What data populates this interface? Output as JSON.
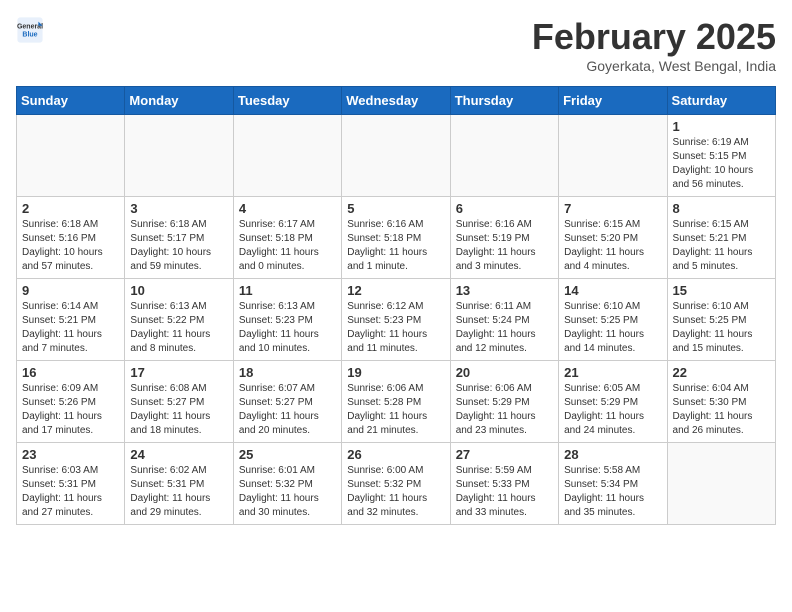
{
  "header": {
    "logo_line1": "General",
    "logo_line2": "Blue",
    "month_year": "February 2025",
    "location": "Goyerkata, West Bengal, India"
  },
  "days_of_week": [
    "Sunday",
    "Monday",
    "Tuesday",
    "Wednesday",
    "Thursday",
    "Friday",
    "Saturday"
  ],
  "weeks": [
    [
      {
        "day": "",
        "info": ""
      },
      {
        "day": "",
        "info": ""
      },
      {
        "day": "",
        "info": ""
      },
      {
        "day": "",
        "info": ""
      },
      {
        "day": "",
        "info": ""
      },
      {
        "day": "",
        "info": ""
      },
      {
        "day": "1",
        "info": "Sunrise: 6:19 AM\nSunset: 5:15 PM\nDaylight: 10 hours and 56 minutes."
      }
    ],
    [
      {
        "day": "2",
        "info": "Sunrise: 6:18 AM\nSunset: 5:16 PM\nDaylight: 10 hours and 57 minutes."
      },
      {
        "day": "3",
        "info": "Sunrise: 6:18 AM\nSunset: 5:17 PM\nDaylight: 10 hours and 59 minutes."
      },
      {
        "day": "4",
        "info": "Sunrise: 6:17 AM\nSunset: 5:18 PM\nDaylight: 11 hours and 0 minutes."
      },
      {
        "day": "5",
        "info": "Sunrise: 6:16 AM\nSunset: 5:18 PM\nDaylight: 11 hours and 1 minute."
      },
      {
        "day": "6",
        "info": "Sunrise: 6:16 AM\nSunset: 5:19 PM\nDaylight: 11 hours and 3 minutes."
      },
      {
        "day": "7",
        "info": "Sunrise: 6:15 AM\nSunset: 5:20 PM\nDaylight: 11 hours and 4 minutes."
      },
      {
        "day": "8",
        "info": "Sunrise: 6:15 AM\nSunset: 5:21 PM\nDaylight: 11 hours and 5 minutes."
      }
    ],
    [
      {
        "day": "9",
        "info": "Sunrise: 6:14 AM\nSunset: 5:21 PM\nDaylight: 11 hours and 7 minutes."
      },
      {
        "day": "10",
        "info": "Sunrise: 6:13 AM\nSunset: 5:22 PM\nDaylight: 11 hours and 8 minutes."
      },
      {
        "day": "11",
        "info": "Sunrise: 6:13 AM\nSunset: 5:23 PM\nDaylight: 11 hours and 10 minutes."
      },
      {
        "day": "12",
        "info": "Sunrise: 6:12 AM\nSunset: 5:23 PM\nDaylight: 11 hours and 11 minutes."
      },
      {
        "day": "13",
        "info": "Sunrise: 6:11 AM\nSunset: 5:24 PM\nDaylight: 11 hours and 12 minutes."
      },
      {
        "day": "14",
        "info": "Sunrise: 6:10 AM\nSunset: 5:25 PM\nDaylight: 11 hours and 14 minutes."
      },
      {
        "day": "15",
        "info": "Sunrise: 6:10 AM\nSunset: 5:25 PM\nDaylight: 11 hours and 15 minutes."
      }
    ],
    [
      {
        "day": "16",
        "info": "Sunrise: 6:09 AM\nSunset: 5:26 PM\nDaylight: 11 hours and 17 minutes."
      },
      {
        "day": "17",
        "info": "Sunrise: 6:08 AM\nSunset: 5:27 PM\nDaylight: 11 hours and 18 minutes."
      },
      {
        "day": "18",
        "info": "Sunrise: 6:07 AM\nSunset: 5:27 PM\nDaylight: 11 hours and 20 minutes."
      },
      {
        "day": "19",
        "info": "Sunrise: 6:06 AM\nSunset: 5:28 PM\nDaylight: 11 hours and 21 minutes."
      },
      {
        "day": "20",
        "info": "Sunrise: 6:06 AM\nSunset: 5:29 PM\nDaylight: 11 hours and 23 minutes."
      },
      {
        "day": "21",
        "info": "Sunrise: 6:05 AM\nSunset: 5:29 PM\nDaylight: 11 hours and 24 minutes."
      },
      {
        "day": "22",
        "info": "Sunrise: 6:04 AM\nSunset: 5:30 PM\nDaylight: 11 hours and 26 minutes."
      }
    ],
    [
      {
        "day": "23",
        "info": "Sunrise: 6:03 AM\nSunset: 5:31 PM\nDaylight: 11 hours and 27 minutes."
      },
      {
        "day": "24",
        "info": "Sunrise: 6:02 AM\nSunset: 5:31 PM\nDaylight: 11 hours and 29 minutes."
      },
      {
        "day": "25",
        "info": "Sunrise: 6:01 AM\nSunset: 5:32 PM\nDaylight: 11 hours and 30 minutes."
      },
      {
        "day": "26",
        "info": "Sunrise: 6:00 AM\nSunset: 5:32 PM\nDaylight: 11 hours and 32 minutes."
      },
      {
        "day": "27",
        "info": "Sunrise: 5:59 AM\nSunset: 5:33 PM\nDaylight: 11 hours and 33 minutes."
      },
      {
        "day": "28",
        "info": "Sunrise: 5:58 AM\nSunset: 5:34 PM\nDaylight: 11 hours and 35 minutes."
      },
      {
        "day": "",
        "info": ""
      }
    ]
  ]
}
